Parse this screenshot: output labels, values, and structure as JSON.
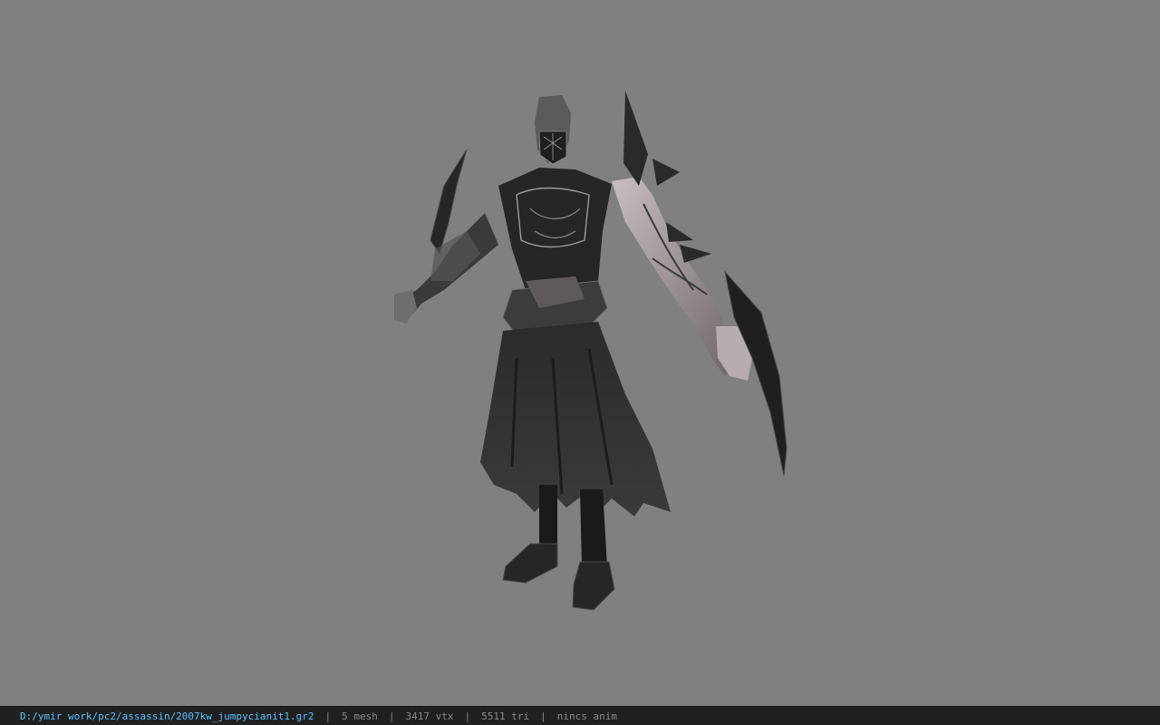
{
  "viewport": {
    "background": "#808080",
    "model_name": "assassin-character-model"
  },
  "statusbar": {
    "file_path": "D:/ymir work/pc2/assassin/2007kw_jumpycianit1.gr2",
    "separator": "|",
    "mesh": "5 mesh",
    "vertices": "3417 vtx",
    "triangles": "5511 tri",
    "anim": "nincs anim",
    "path_color": "#5ec0ff",
    "text_color": "#8a8a8a"
  }
}
